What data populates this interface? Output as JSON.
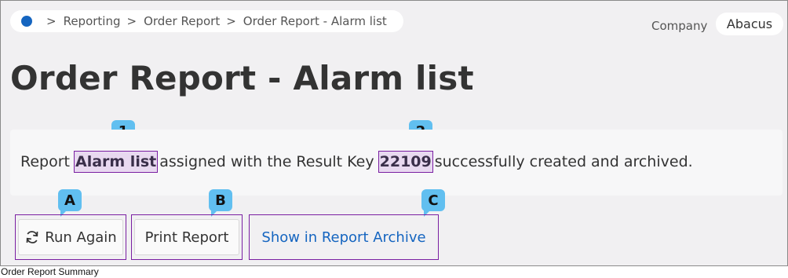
{
  "breadcrumb": {
    "items": [
      "Reporting",
      "Order Report",
      "Order Report - Alarm list"
    ],
    "separator": ">"
  },
  "company": {
    "label": "Company",
    "value": "Abacus"
  },
  "page_title": "Order Report - Alarm list",
  "message": {
    "prefix": "Report",
    "report_name": "Alarm list",
    "middle": "assigned with the Result Key",
    "result_key": "22109",
    "suffix": "successfully created and archived."
  },
  "callouts": {
    "report_name": "1",
    "result_key": "2",
    "run_again": "A",
    "print_report": "B",
    "show_archive": "C"
  },
  "buttons": {
    "run_again": "Run Again",
    "print_report": "Print Report",
    "show_archive": "Show in Report Archive"
  },
  "caption": "Order Report Summary",
  "colors": {
    "accent": "#1565c0",
    "highlight_border": "#7a1fa2",
    "badge": "#61bff0"
  },
  "icons": {
    "home": "home-dot-icon",
    "refresh": "refresh-icon"
  }
}
